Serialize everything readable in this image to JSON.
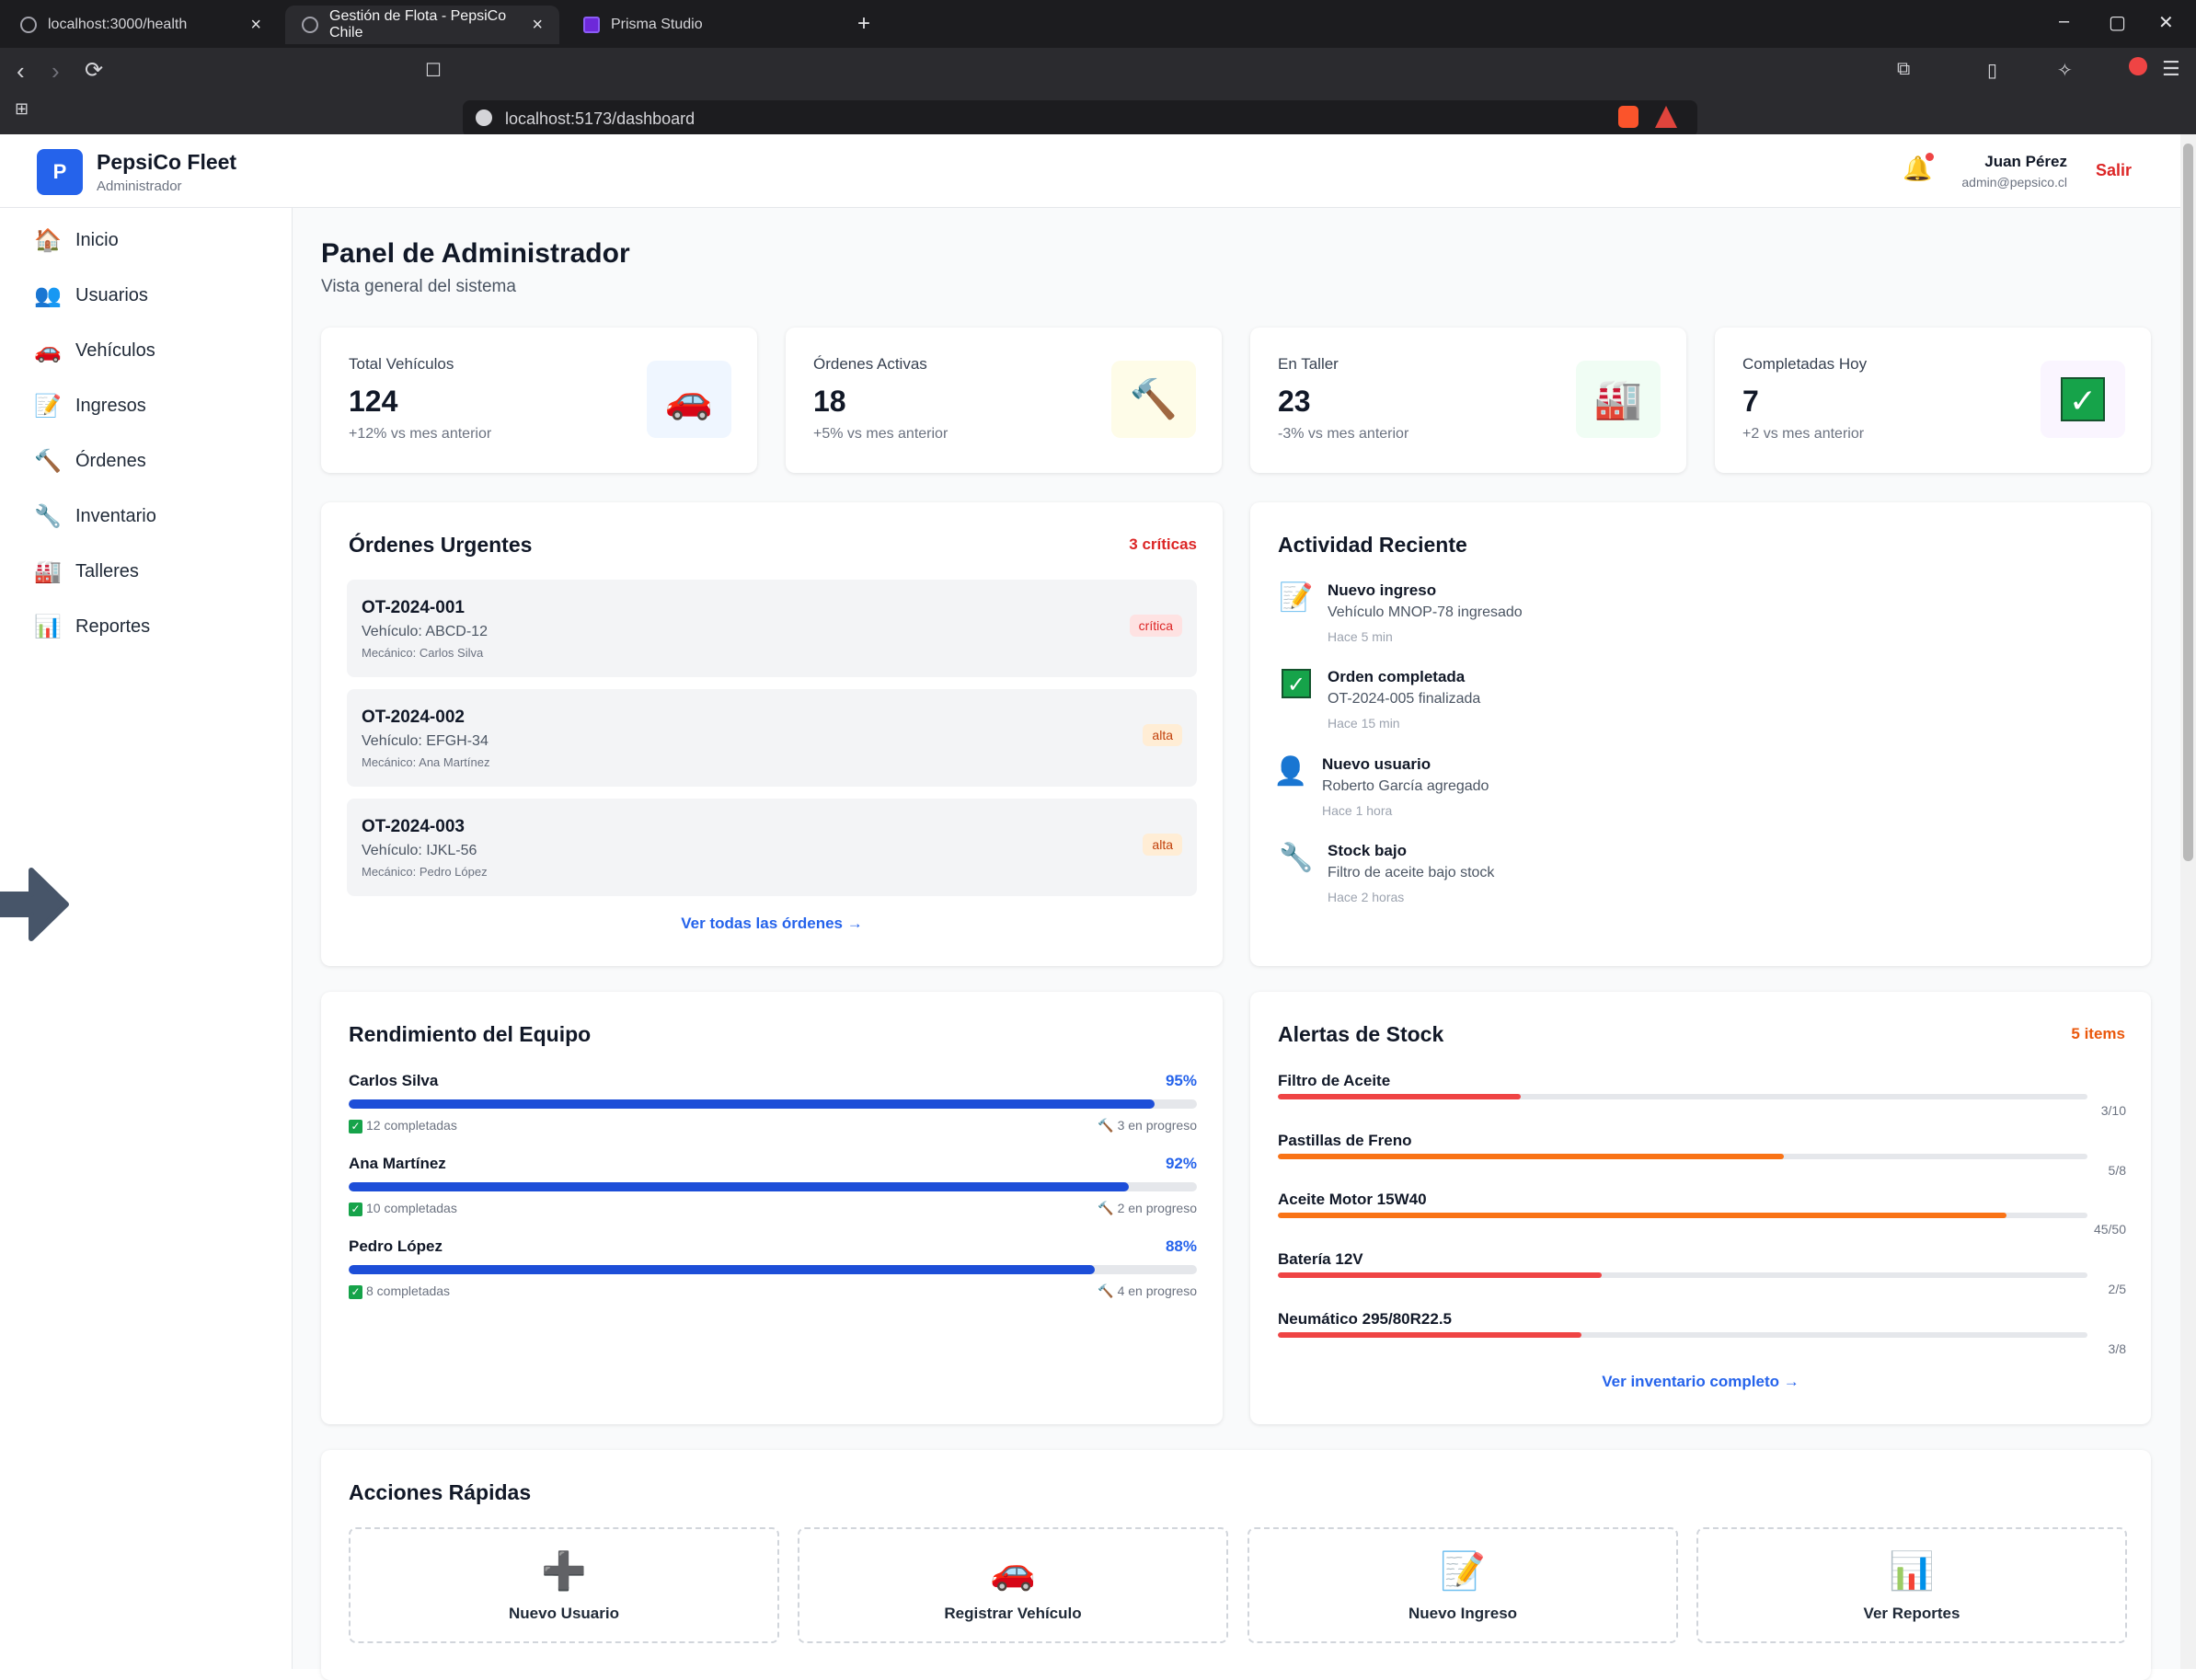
{
  "browser": {
    "tabs": [
      {
        "title": "localhost:3000/health",
        "active": false
      },
      {
        "title": "Gestión de Flota - PepsiCo Chile",
        "active": true
      },
      {
        "title": "Prisma Studio",
        "active": false
      }
    ],
    "url": "localhost:5173/dashboard",
    "window_controls": [
      "–",
      "▢",
      "✕"
    ]
  },
  "header": {
    "logo_letter": "P",
    "brand": "PepsiCo Fleet",
    "role": "Administrador",
    "user_name": "Juan Pérez",
    "user_email": "admin@pepsico.cl",
    "logout": "Salir"
  },
  "sidebar": {
    "items": [
      {
        "label": "Inicio",
        "icon": "home-icon"
      },
      {
        "label": "Usuarios",
        "icon": "users-icon"
      },
      {
        "label": "Vehículos",
        "icon": "car-icon"
      },
      {
        "label": "Ingresos",
        "icon": "memo-icon"
      },
      {
        "label": "Órdenes",
        "icon": "hammer-icon"
      },
      {
        "label": "Inventario",
        "icon": "wrench-icon"
      },
      {
        "label": "Talleres",
        "icon": "factory-icon"
      },
      {
        "label": "Reportes",
        "icon": "chart-icon"
      }
    ]
  },
  "page": {
    "title": "Panel de Administrador",
    "subtitle": "Vista general del sistema"
  },
  "stats": [
    {
      "label": "Total Vehículos",
      "value": "124",
      "change": "+12% vs mes anterior",
      "icon": "car-icon",
      "icon_bg": "#eff6ff"
    },
    {
      "label": "Órdenes Activas",
      "value": "18",
      "change": "+5% vs mes anterior",
      "icon": "hammer-icon",
      "icon_bg": "#fefce8"
    },
    {
      "label": "En Taller",
      "value": "23",
      "change": "-3% vs mes anterior",
      "icon": "factory-icon",
      "icon_bg": "#f0fdf4"
    },
    {
      "label": "Completadas Hoy",
      "value": "7",
      "change": "+2 vs mes anterior",
      "icon": "check-icon",
      "icon_bg": "#faf5ff"
    }
  ],
  "urgent": {
    "title": "Órdenes Urgentes",
    "badge": "3 críticas",
    "orders": [
      {
        "id": "OT-2024-001",
        "vehicle": "Vehículo: ABCD-12",
        "mechanic": "Mecánico: Carlos Silva",
        "priority": "crítica"
      },
      {
        "id": "OT-2024-002",
        "vehicle": "Vehículo: EFGH-34",
        "mechanic": "Mecánico: Ana Martínez",
        "priority": "alta"
      },
      {
        "id": "OT-2024-003",
        "vehicle": "Vehículo: IJKL-56",
        "mechanic": "Mecánico: Pedro López",
        "priority": "alta"
      }
    ],
    "link": "Ver todas las órdenes →"
  },
  "activity": {
    "title": "Actividad Reciente",
    "items": [
      {
        "title": "Nuevo ingreso",
        "desc": "Vehículo MNOP-78 ingresado",
        "time": "Hace 5 min",
        "icon": "memo-icon"
      },
      {
        "title": "Orden completada",
        "desc": "OT-2024-005 finalizada",
        "time": "Hace 15 min",
        "icon": "check-icon"
      },
      {
        "title": "Nuevo usuario",
        "desc": "Roberto García agregado",
        "time": "Hace 1 hora",
        "icon": "user-icon"
      },
      {
        "title": "Stock bajo",
        "desc": "Filtro de aceite bajo stock",
        "time": "Hace 2 horas",
        "icon": "wrench-icon"
      }
    ]
  },
  "performance": {
    "title": "Rendimiento del Equipo",
    "members": [
      {
        "name": "Carlos Silva",
        "percent": "95%",
        "value": 0.95,
        "completed": "12 completadas",
        "in_progress": "3 en progreso"
      },
      {
        "name": "Ana Martínez",
        "percent": "92%",
        "value": 0.92,
        "completed": "10 completadas",
        "in_progress": "2 en progreso"
      },
      {
        "name": "Pedro López",
        "percent": "88%",
        "value": 0.88,
        "completed": "8 completadas",
        "in_progress": "4 en progreso"
      }
    ],
    "bar_color": "#1d4ed8"
  },
  "stock": {
    "title": "Alertas de Stock",
    "badge": "5 items",
    "items": [
      {
        "name": "Filtro de Aceite",
        "count": "3/10",
        "value": 0.3,
        "color": "#ef4444"
      },
      {
        "name": "Pastillas de Freno",
        "count": "5/8",
        "value": 0.625,
        "color": "#f97316"
      },
      {
        "name": "Aceite Motor 15W40",
        "count": "45/50",
        "value": 0.9,
        "color": "#f97316"
      },
      {
        "name": "Batería 12V",
        "count": "2/5",
        "value": 0.4,
        "color": "#ef4444"
      },
      {
        "name": "Neumático 295/80R22.5",
        "count": "3/8",
        "value": 0.375,
        "color": "#ef4444"
      }
    ],
    "link": "Ver inventario completo →"
  },
  "quick_actions": {
    "title": "Acciones Rápidas",
    "items": [
      {
        "label": "Nuevo Usuario",
        "icon": "plus-icon"
      },
      {
        "label": "Registrar Vehículo",
        "icon": "car-icon"
      },
      {
        "label": "Nuevo Ingreso",
        "icon": "memo-icon"
      },
      {
        "label": "Ver Reportes",
        "icon": "chart-icon"
      }
    ]
  }
}
